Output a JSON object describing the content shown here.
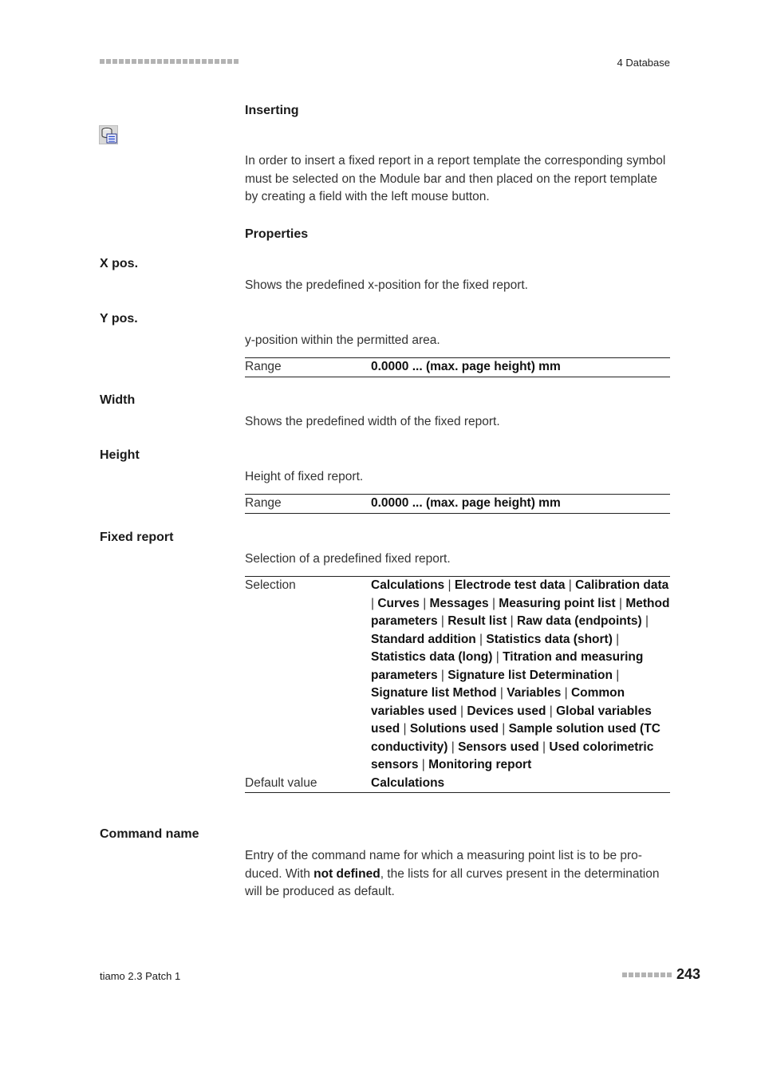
{
  "header": {
    "chapter": "4 Database"
  },
  "sections": {
    "inserting": {
      "title": "Inserting",
      "icon": "fixed-report-module-icon",
      "text": "In order to insert a fixed report in a report template the corresponding symbol must be selected on the Module bar and then placed on the report template by creating a field with the left mouse button."
    },
    "properties": {
      "title": "Properties"
    }
  },
  "properties": {
    "x_pos": {
      "label": "X pos.",
      "text": "Shows the predefined x-position for the fixed report."
    },
    "y_pos": {
      "label": "Y pos.",
      "text": "y-position within the permitted area.",
      "range_key": "Range",
      "range_value": "0.0000 ... (max. page height) mm"
    },
    "width": {
      "label": "Width",
      "text": "Shows the predefined width of the fixed report."
    },
    "height": {
      "label": "Height",
      "text": "Height of fixed report.",
      "range_key": "Range",
      "range_value": "0.0000 ... (max. page height) mm"
    },
    "fixed_report": {
      "label": "Fixed report",
      "text": "Selection of a predefined fixed report.",
      "selection_key": "Selection",
      "selection_options": [
        "Calculations",
        "Electrode test data",
        "Calibration data",
        "Curves",
        "Messages",
        "Measuring point list",
        "Method parameters",
        "Result list",
        "Raw data (endpoints)",
        "Standard addition",
        "Statistics data (short)",
        "Statistics data (long)",
        "Titration and measuring parameters",
        "Signature list Determination",
        "Signature list Method",
        "Variables",
        "Common variables used",
        "Devices used",
        "Global variables used",
        "Solutions used",
        "Sample solution used (TC conductivity)",
        "Sensors used",
        "Used colorimetric sensors",
        "Monitoring report"
      ],
      "default_key": "Default value",
      "default_value": "Calculations"
    },
    "command_name": {
      "label": "Command name",
      "text_before": "Entry of the command name for which a measuring point list is to be pro­duced. With ",
      "text_bold": "not defined",
      "text_after": ", the lists for all curves present in the determina­tion will be produced as default."
    }
  },
  "footer": {
    "product": "tiamo 2.3 Patch 1",
    "page_number": "243"
  }
}
